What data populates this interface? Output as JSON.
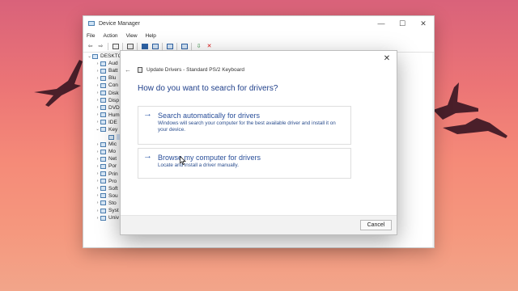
{
  "device_manager": {
    "title": "Device Manager",
    "window_controls": {
      "minimize": "—",
      "maximize": "☐",
      "close": "✕"
    },
    "menu": [
      "File",
      "Action",
      "View",
      "Help"
    ],
    "tree": [
      {
        "label": "DESKTC",
        "chev": "⌄",
        "icon": "computer-icon",
        "indent": 0
      },
      {
        "label": "Aud",
        "chev": "›",
        "icon": "audio-icon",
        "indent": 1
      },
      {
        "label": "Batt",
        "chev": "›",
        "icon": "battery-icon",
        "indent": 1
      },
      {
        "label": "Blu",
        "chev": "›",
        "icon": "bluetooth-icon",
        "indent": 1
      },
      {
        "label": "Con",
        "chev": "›",
        "icon": "computer-icon",
        "indent": 1
      },
      {
        "label": "Disk",
        "chev": "›",
        "icon": "disk-drives-icon",
        "indent": 1
      },
      {
        "label": "Disp",
        "chev": "›",
        "icon": "display-adapter-icon",
        "indent": 1
      },
      {
        "label": "DVD",
        "chev": "›",
        "icon": "dvd-drive-icon",
        "indent": 1
      },
      {
        "label": "Hum",
        "chev": "›",
        "icon": "hid-icon",
        "indent": 1
      },
      {
        "label": "IDE",
        "chev": "›",
        "icon": "ide-controller-icon",
        "indent": 1
      },
      {
        "label": "Key",
        "chev": "⌄",
        "icon": "keyboard-icon",
        "indent": 1
      },
      {
        "label": "",
        "chev": "",
        "icon": "keyboard-device-icon",
        "indent": 2,
        "selected": true
      },
      {
        "label": "Mic",
        "chev": "›",
        "icon": "mouse-icon",
        "indent": 1
      },
      {
        "label": "Mo",
        "chev": "›",
        "icon": "monitor-icon",
        "indent": 1
      },
      {
        "label": "Net",
        "chev": "›",
        "icon": "network-adapter-icon",
        "indent": 1
      },
      {
        "label": "Por",
        "chev": "›",
        "icon": "ports-icon",
        "indent": 1
      },
      {
        "label": "Prin",
        "chev": "›",
        "icon": "printer-icon",
        "indent": 1
      },
      {
        "label": "Pro",
        "chev": "›",
        "icon": "processor-icon",
        "indent": 1
      },
      {
        "label": "Soft",
        "chev": "›",
        "icon": "software-device-icon",
        "indent": 1
      },
      {
        "label": "Sou",
        "chev": "›",
        "icon": "sound-icon",
        "indent": 1
      },
      {
        "label": "Sto",
        "chev": "›",
        "icon": "storage-controller-icon",
        "indent": 1
      },
      {
        "label": "Syst",
        "chev": "›",
        "icon": "system-devices-icon",
        "indent": 1
      },
      {
        "label": "Univ",
        "chev": "›",
        "icon": "usb-icon",
        "indent": 1
      }
    ]
  },
  "dialog": {
    "title": "Update Drivers - Standard PS/2 Keyboard",
    "close": "✕",
    "back": "←",
    "question": "How do you want to search for drivers?",
    "options": [
      {
        "title": "Search automatically for drivers",
        "description": "Windows will search your computer for the best available driver and install it on your device."
      },
      {
        "title": "Browse my computer for drivers",
        "description": "Locate and install a driver manually."
      }
    ],
    "arrow": "→",
    "cancel_label": "Cancel"
  },
  "colors": {
    "accent_link": "#2a4f9a",
    "question_text": "#1f3f8a",
    "background_top": "#d9627a",
    "background_bottom": "#f2a58a"
  }
}
